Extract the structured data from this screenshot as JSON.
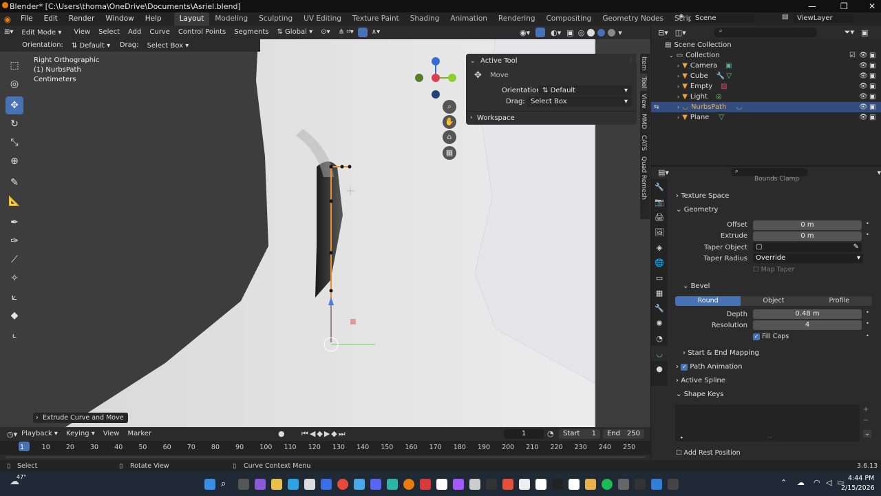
{
  "window": {
    "title": "Blender* [C:\\Users\\thoma\\OneDrive\\Documents\\Asriel.blend]"
  },
  "menu": [
    "File",
    "Edit",
    "Render",
    "Window",
    "Help"
  ],
  "workspaces": [
    "Layout",
    "Modeling",
    "Sculpting",
    "UV Editing",
    "Texture Paint",
    "Shading",
    "Animation",
    "Rendering",
    "Compositing",
    "Geometry Nodes",
    "Scripting"
  ],
  "scene": {
    "label": "Scene",
    "view_layer": "ViewLayer"
  },
  "viewport_header": {
    "mode": "Edit Mode",
    "menus": [
      "View",
      "Select",
      "Add",
      "Curve",
      "Control Points",
      "Segments"
    ],
    "transform_orientation": "Global",
    "orientation_label": "Orientation:",
    "orientation_value": "Default",
    "drag_label": "Drag:",
    "drag_value": "Select Box"
  },
  "viewport_info": {
    "view": "Right Orthographic",
    "object": "(1) NurbsPath",
    "units": "Centimeters"
  },
  "last_operator": "Extrude Curve and Move",
  "npanel": {
    "title": "Active Tool",
    "tool": "Move",
    "orientation_label": "Orientation",
    "orientation_value": "Default",
    "drag_label": "Drag:",
    "drag_value": "Select Box",
    "workspace": "Workspace"
  },
  "side_tabs": [
    "Item",
    "Tool",
    "View",
    "MMD",
    "CATS",
    "Quad Remesh"
  ],
  "outliner": {
    "root": "Scene Collection",
    "collection": "Collection",
    "items": [
      {
        "name": "Camera",
        "selected": false
      },
      {
        "name": "Cube",
        "selected": false
      },
      {
        "name": "Empty",
        "selected": false
      },
      {
        "name": "Light",
        "selected": false
      },
      {
        "name": "NurbsPath",
        "selected": true
      },
      {
        "name": "Plane",
        "selected": false
      }
    ]
  },
  "properties": {
    "bounds_clamp": "Bounds Clamp",
    "texture_space": "Texture Space",
    "geometry": "Geometry",
    "offset_label": "Offset",
    "offset_value": "0 m",
    "extrude_label": "Extrude",
    "extrude_value": "0 m",
    "taper_object_label": "Taper Object",
    "taper_radius_label": "Taper Radius",
    "taper_radius_value": "Override",
    "map_taper": "Map Taper",
    "bevel": "Bevel",
    "bevel_modes": [
      "Round",
      "Object",
      "Profile"
    ],
    "depth_label": "Depth",
    "depth_value": "0.48 m",
    "resolution_label": "Resolution",
    "resolution_value": "4",
    "fill_caps": "Fill Caps",
    "start_end": "Start & End Mapping",
    "path_animation": "Path Animation",
    "active_spline": "Active Spline",
    "shape_keys": "Shape Keys",
    "add_rest_position": "Add Rest Position"
  },
  "timeline": {
    "menus": [
      "Playback",
      "Keying",
      "View",
      "Marker"
    ],
    "current_frame": "1",
    "start_label": "Start",
    "start_value": "1",
    "end_label": "End",
    "end_value": "250",
    "ticks": [
      "1",
      "10",
      "20",
      "30",
      "40",
      "50",
      "60",
      "70",
      "80",
      "90",
      "100",
      "110",
      "120",
      "130",
      "140",
      "150",
      "160",
      "170",
      "180",
      "190",
      "200",
      "210",
      "220",
      "230",
      "240",
      "250"
    ]
  },
  "status": {
    "select": "Select",
    "rotate": "Rotate View",
    "context": "Curve Context Menu",
    "version": "3.6.13"
  },
  "taskbar": {
    "temp": "47°",
    "time": "4:44 PM",
    "date": "2/15/2026"
  }
}
